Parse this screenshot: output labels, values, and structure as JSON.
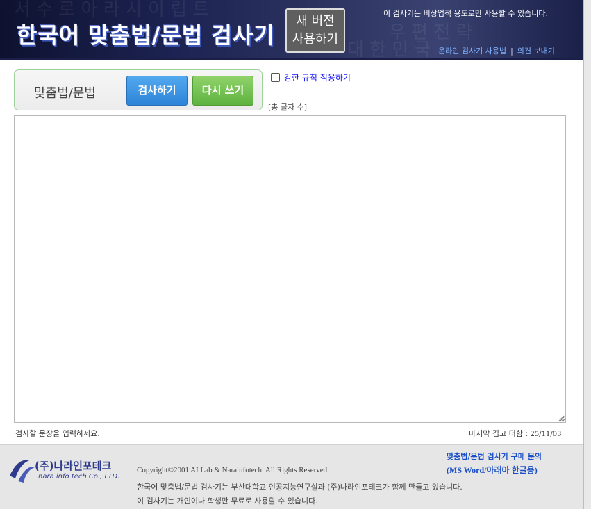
{
  "header": {
    "title": "한국어 맞춤법/문법 검사기",
    "new_version_line1": "새 버전",
    "new_version_line2": "사용하기",
    "notice": "이 검사기는 비상업적 용도로만 사용할 수 있습니다.",
    "link_usage": "온라인 검사기 사용법",
    "link_separator": "|",
    "link_feedback": "의견 보내기"
  },
  "panel": {
    "label": "맞춤법/문법",
    "check_button": "검사하기",
    "rewrite_button": "다시 쓰기"
  },
  "options": {
    "strict_rule": "강한 규칙 적용하기",
    "strict_checked": false,
    "char_count": "[총 글자 수]"
  },
  "editor": {
    "value": "",
    "hint": "검사할 문장을 입력하세요.",
    "last_update_label": "마지막 깁고 더함 : ",
    "last_update_date": "25/11/03"
  },
  "footer": {
    "company_name": "(주)나라인포테크",
    "company_sub": "nara info tech Co., LTD.",
    "copyright": "Copyright©2001 AI Lab & Narainfotech. All Rights Reserved",
    "line1": "한국어 맞춤법/문법 검사기는 부산대학교 인공지능연구실과 (주)나라인포테크가 함께 만들고 있습니다.",
    "line2": "이 검사기는 개인이나 학생만 무료로 사용할 수 있습니다.",
    "buy_link": "맞춤법/문법 검사기 구매 문의",
    "buy_sub": "(MS Word/아래아 한글용)"
  },
  "colors": {
    "header_bg": "#1d2352",
    "check_button": "#2d84d8",
    "rewrite_button": "#5fb340",
    "link_blue": "#1a4fc7"
  }
}
